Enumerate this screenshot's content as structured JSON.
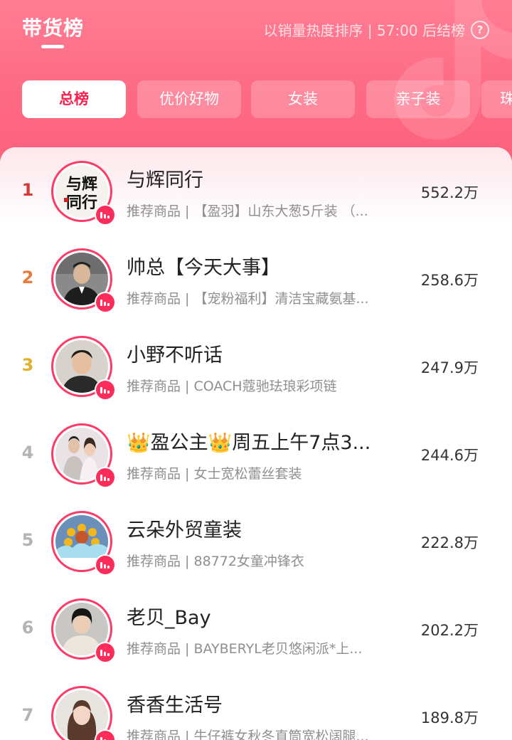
{
  "header": {
    "title": "带货榜",
    "rule_text": "以销量热度排序 | 57:00 后结榜",
    "help_icon": "question-circle-icon",
    "brand_logo": "douyin-logo"
  },
  "tabs": [
    {
      "label": "总榜",
      "active": true
    },
    {
      "label": "优价好物",
      "active": false
    },
    {
      "label": "女装",
      "active": false
    },
    {
      "label": "亲子装",
      "active": false
    },
    {
      "label": "珠",
      "active": false
    }
  ],
  "colors": {
    "brand_pink": "#fe3a66",
    "rank_1": "#d33a3a",
    "rank_2": "#e87a3a",
    "rank_3": "#e3b12f",
    "rank_other": "#b4b4b4"
  },
  "items": [
    {
      "rank": "1",
      "name": "与辉同行",
      "sub": "推荐商品 | 【盈羽】山东大葱5斤装 （...",
      "value": "552.2万",
      "avatar": "calligraphy-logo-avatar"
    },
    {
      "rank": "2",
      "name": "帅总【今天大事】",
      "sub": "推荐商品 | 【宠粉福利】清洁宝藏氨基...",
      "value": "258.6万",
      "avatar": "man-in-suit-avatar"
    },
    {
      "rank": "3",
      "name": "小野不听话",
      "sub": "推荐商品 | COACH蔻驰珐琅彩项链",
      "value": "247.9万",
      "avatar": "man-portrait-avatar"
    },
    {
      "rank": "4",
      "name": "👑盈公主👑周五上午7点3...",
      "sub": "推荐商品 | 女士宽松蕾丝套装",
      "value": "244.6万",
      "avatar": "couple-wedding-avatar"
    },
    {
      "rank": "5",
      "name": "云朵外贸童装",
      "sub": "推荐商品 | 88772女童冲锋衣",
      "value": "222.8万",
      "avatar": "sunflower-logo-avatar"
    },
    {
      "rank": "6",
      "name": "老贝_Bay",
      "sub": "推荐商品 | BAYBERYL老贝悠闲派*上...",
      "value": "202.2万",
      "avatar": "woman-short-hair-avatar"
    },
    {
      "rank": "7",
      "name": "香香生活号",
      "sub": "推荐商品 | 牛仔裤女秋冬直筒宽松阔腿...",
      "value": "189.8万",
      "avatar": "woman-portrait-avatar"
    }
  ]
}
